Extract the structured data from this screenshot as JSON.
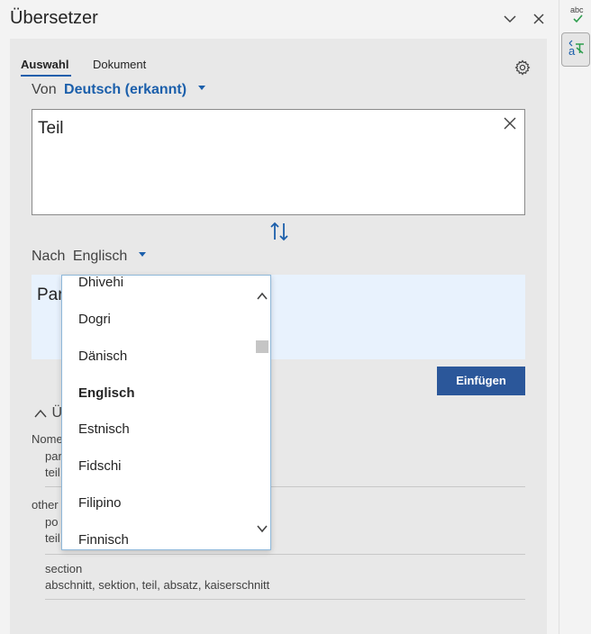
{
  "header": {
    "title": "Übersetzer"
  },
  "tabs": [
    {
      "label": "Auswahl",
      "active": true
    },
    {
      "label": "Dokument",
      "active": false
    }
  ],
  "source": {
    "label": "Von",
    "language": "Deutsch (erkannt)",
    "text": "Teil"
  },
  "target": {
    "label": "Nach",
    "language": "Englisch",
    "text_visible": "Par"
  },
  "insert_button": "Einfügen",
  "section": {
    "toggle_text": "Ü"
  },
  "definitions": [
    {
      "pos": "Nome",
      "lines": [
        "par",
        "teil"
      ]
    },
    {
      "pos": "other",
      "lines": [
        "po",
        "teil"
      ]
    },
    {
      "pos": "",
      "lines": [
        "section",
        "abschnitt, sektion, teil, absatz, kaiserschnitt"
      ]
    }
  ],
  "dropdown": {
    "items": [
      "Dhivehi",
      "Dogri",
      "Dänisch",
      "Englisch",
      "Estnisch",
      "Fidschi",
      "Filipino",
      "Finnisch"
    ],
    "selected": "Englisch"
  },
  "sidebar": {
    "editor_badge": "abc"
  },
  "colors": {
    "accent": "#2b579a",
    "link": "#1b5fab",
    "target_bg": "#e8f2fd"
  },
  "icons": [
    "chevron-down-icon",
    "close-icon",
    "gear-icon",
    "swap-icon",
    "chevron-up-icon",
    "editor-icon",
    "translator-icon"
  ]
}
